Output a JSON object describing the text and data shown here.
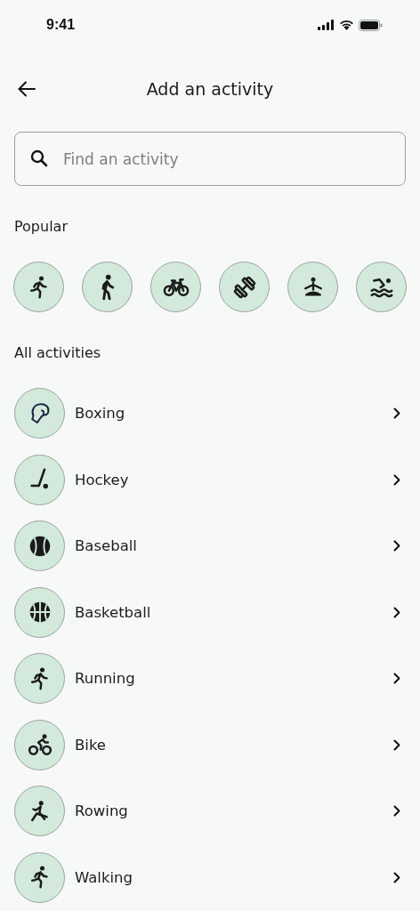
{
  "status_bar": {
    "time": "9:41"
  },
  "header": {
    "title": "Add an activity"
  },
  "search": {
    "placeholder": "Find an activity"
  },
  "popular": {
    "heading": "Popular"
  },
  "all_activities": {
    "heading": "All activities",
    "items": [
      {
        "label": "Boxing"
      },
      {
        "label": "Hockey"
      },
      {
        "label": "Baseball"
      },
      {
        "label": "Basketball"
      },
      {
        "label": "Running"
      },
      {
        "label": "Bike"
      },
      {
        "label": "Rowing"
      },
      {
        "label": "Walking"
      }
    ]
  }
}
